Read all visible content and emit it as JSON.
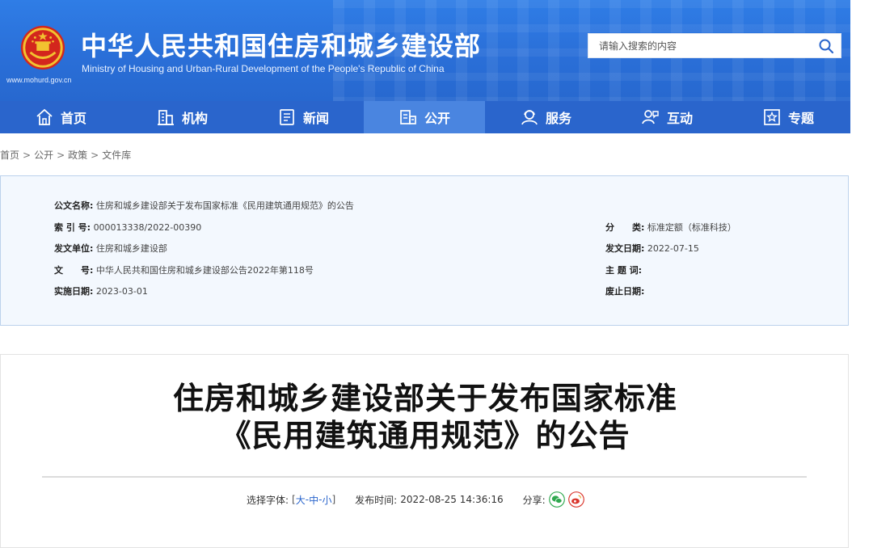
{
  "header": {
    "site_url": "www.mohurd.gov.cn",
    "title": "中华人民共和国住房和城乡建设部",
    "subtitle": "Ministry of Housing and Urban-Rural Development of the People's Republic of China",
    "search_placeholder": "请输入搜索的内容",
    "colors": {
      "banner": "#2f7de6",
      "nav": "#2a65cc",
      "nav_active": "#4a85e0"
    }
  },
  "nav": {
    "items": [
      {
        "label": "首页",
        "icon": "home-icon"
      },
      {
        "label": "机构",
        "icon": "building-icon"
      },
      {
        "label": "新闻",
        "icon": "news-icon"
      },
      {
        "label": "公开",
        "icon": "public-info-icon",
        "active": true
      },
      {
        "label": "服务",
        "icon": "service-icon"
      },
      {
        "label": "互动",
        "icon": "interact-icon"
      },
      {
        "label": "专题",
        "icon": "star-topic-icon"
      }
    ]
  },
  "breadcrumb": [
    "首页",
    "公开",
    "政策",
    "文件库"
  ],
  "info": {
    "doc_name_label": "公文名称:",
    "doc_name": "住房和城乡建设部关于发布国家标准《民用建筑通用规范》的公告",
    "index_label": "索 引 号:",
    "index": "000013338/2022-00390",
    "category_label": "分　　类:",
    "category": "标准定额（标准科技）",
    "issuer_label": "发文单位:",
    "issuer": "住房和城乡建设部",
    "issue_date_label": "发文日期:",
    "issue_date": "2022-07-15",
    "doc_no_label": "文　　号:",
    "doc_no": "中华人民共和国住房和城乡建设部公告2022年第118号",
    "keywords_label": "主 题 词:",
    "keywords": "",
    "effective_date_label": "实施日期:",
    "effective_date": "2023-03-01",
    "repeal_date_label": "废止日期:",
    "repeal_date": ""
  },
  "article": {
    "title_line1": "住房和城乡建设部关于发布国家标准",
    "title_line2": "《民用建筑通用规范》的公告",
    "font_label": "选择字体:",
    "font_open": "[",
    "font_large": "大",
    "font_medium": "中",
    "font_small": "小",
    "font_close": "]",
    "font_sep": "-",
    "publish_label": "发布时间:",
    "publish_time": "2022-08-25 14:36:16",
    "share_label": "分享:",
    "share_icons": [
      "wechat-icon",
      "weibo-icon"
    ]
  }
}
